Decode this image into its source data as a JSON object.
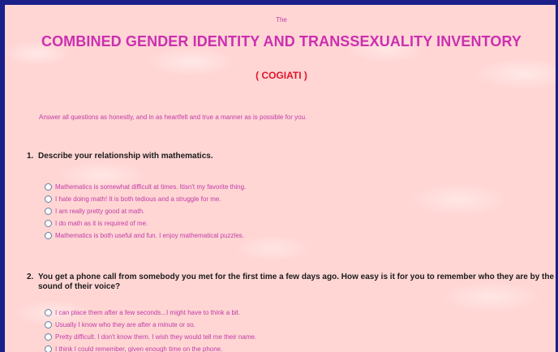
{
  "header": {
    "the": "The",
    "title": "COMBINED GENDER IDENTITY AND TRANSSEXUALITY INVENTORY",
    "subtitle": "( COGIATI )"
  },
  "intro": "Answer all questions as honestly, and in as heartfelt and true a manner as is possible for you.",
  "questions": [
    {
      "number": "1.",
      "text": "Describe your relationship with mathematics.",
      "options": [
        "Mathematics is somewhat difficult at times. Itisn't my favorite thing.",
        "I hate doing math! It is both tedious and a struggle for me.",
        "I am really pretty good at math.",
        "I do math as it is required of me.",
        "Mathematics is both useful and fun. I enjoy mathematical puzzles."
      ]
    },
    {
      "number": "2.",
      "text": "You get a phone call from somebody you met for the first time a few days ago. How easy is it for you to remember who they are by the sound of their voice?",
      "options": [
        "I can place them after a few seconds...I might have to think a bit.",
        "Usually I know who they are after a minute or so.",
        "Pretty difficult. I don't know them. I wish they would tell me their name.",
        "I think I could remember, given enough time on the phone."
      ]
    }
  ],
  "colors": {
    "background": "#ffd6d4",
    "frame": "#1a1f8a",
    "title": "#cc2fb0",
    "subtitle": "#e0142a",
    "option_text": "#c03ca8",
    "question_text": "#1b1b1b"
  }
}
